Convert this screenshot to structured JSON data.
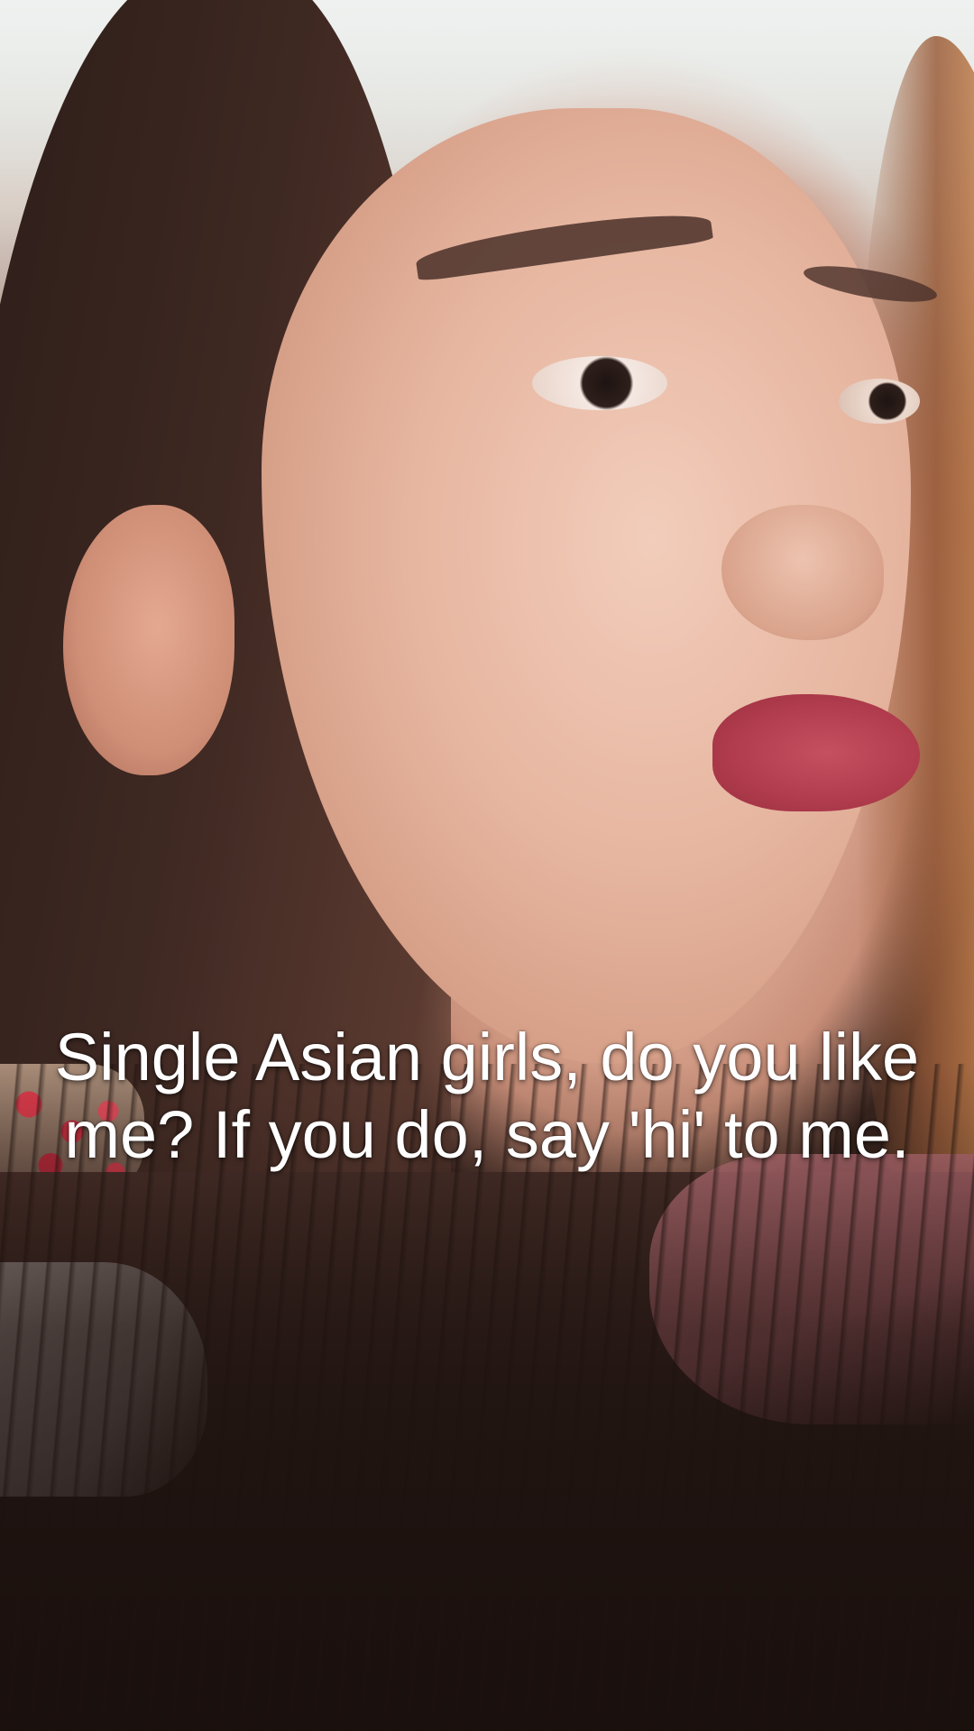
{
  "caption": {
    "text": "Single Asian girls, do you like me? If you do, say 'hi' to me."
  }
}
